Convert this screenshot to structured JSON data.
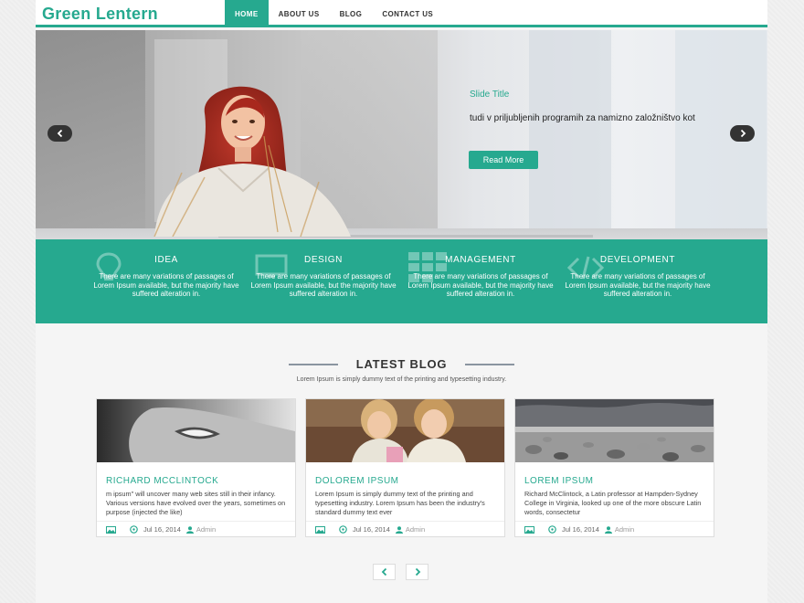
{
  "header": {
    "logo": "Green Lentern",
    "nav": [
      {
        "label": "HOME",
        "active": true
      },
      {
        "label": "ABOUT US",
        "active": false
      },
      {
        "label": "BLOG",
        "active": false
      },
      {
        "label": "CONTACT US",
        "active": false
      }
    ]
  },
  "slider": {
    "title": "Slide Title",
    "text": "tudi v priljubljenih programih za namizno založništvo kot",
    "button": "Read More",
    "prev_icon": "chevron-left-icon",
    "next_icon": "chevron-right-icon"
  },
  "features": [
    {
      "title": "IDEA",
      "text": "There are many variations of passages of Lorem Ipsum available, but the majority have suffered alteration in.",
      "icon": "lightbulb-icon"
    },
    {
      "title": "DESIGN",
      "text": "There are many variations of passages of Lorem Ipsum available, but the majority have suffered alteration in.",
      "icon": "monitor-icon"
    },
    {
      "title": "MANAGEMENT",
      "text": "There are many variations of passages of Lorem Ipsum available, but the majority have suffered alteration in.",
      "icon": "grid-icon"
    },
    {
      "title": "DEVELOPMENT",
      "text": "There are many variations of passages of Lorem Ipsum available, but the majority have suffered alteration in.",
      "icon": "code-icon"
    }
  ],
  "blog": {
    "title": "LATEST BLOG",
    "subtitle": "Lorem Ipsum is simply dummy text of the printing and typesetting industry.",
    "posts": [
      {
        "title": "RICHARD MCCLINTOCK",
        "text": "m ipsum\" will uncover many web sites still in their infancy. Various versions have evolved over the years, sometimes on purpose (injected the like)",
        "date": "Jul 16, 2014",
        "author": "Admin"
      },
      {
        "title": "DOLOREM IPSUM",
        "text": "Lorem Ipsum is simply dummy text of the printing and typesetting industry. Lorem Ipsum has been the industry's standard dummy text ever",
        "date": "Jul 16, 2014",
        "author": "Admin"
      },
      {
        "title": "LOREM IPSUM",
        "text": "Richard McClintock, a Latin professor at Hampden-Sydney College in Virginia, looked up one of the more obscure Latin words, consectetur",
        "date": "Jul 16, 2014",
        "author": "Admin"
      }
    ]
  },
  "pager": {
    "prev_icon": "chevron-left-icon",
    "next_icon": "chevron-right-icon"
  },
  "colors": {
    "accent": "#26a98f",
    "dark": "#333333"
  }
}
